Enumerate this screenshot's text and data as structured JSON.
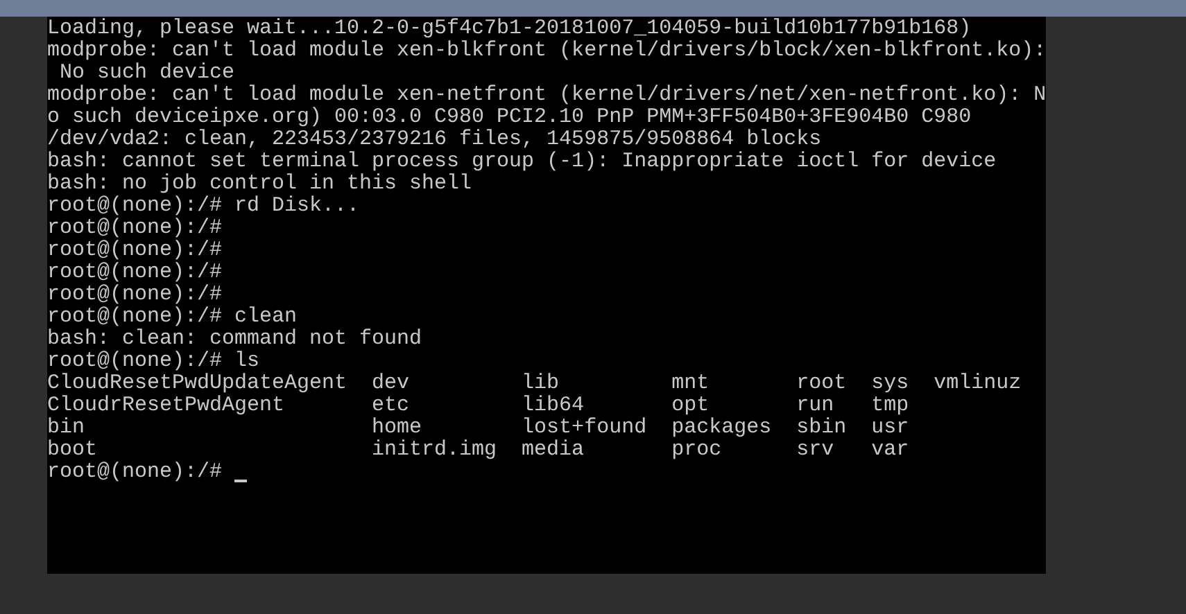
{
  "console": {
    "lines": [
      "Loading, please wait...10.2-0-g5f4c7b1-20181007_104059-build10b177b91b168)",
      "modprobe: can't load module xen-blkfront (kernel/drivers/block/xen-blkfront.ko):",
      " No such device",
      "modprobe: can't load module xen-netfront (kernel/drivers/net/xen-netfront.ko): N",
      "o such deviceipxe.org) 00:03.0 C980 PCI2.10 PnP PMM+3FF504B0+3FE904B0 C980",
      "/dev/vda2: clean, 223453/2379216 files, 1459875/9508864 blocks",
      "bash: cannot set terminal process group (-1): Inappropriate ioctl for device",
      "bash: no job control in this shell",
      "root@(none):/# rd Disk...",
      "root@(none):/#",
      "root@(none):/#",
      "root@(none):/#",
      "root@(none):/#",
      "root@(none):/# clean",
      "bash: clean: command not found",
      "root@(none):/# ls",
      "CloudResetPwdUpdateAgent  dev         lib         mnt       root  sys  vmlinuz",
      "CloudrResetPwdAgent       etc         lib64       opt       run   tmp",
      "bin                       home        lost+found  packages  sbin  usr",
      "boot                      initrd.img  media       proc      srv   var",
      "root@(none):/#"
    ],
    "cursor": true
  }
}
